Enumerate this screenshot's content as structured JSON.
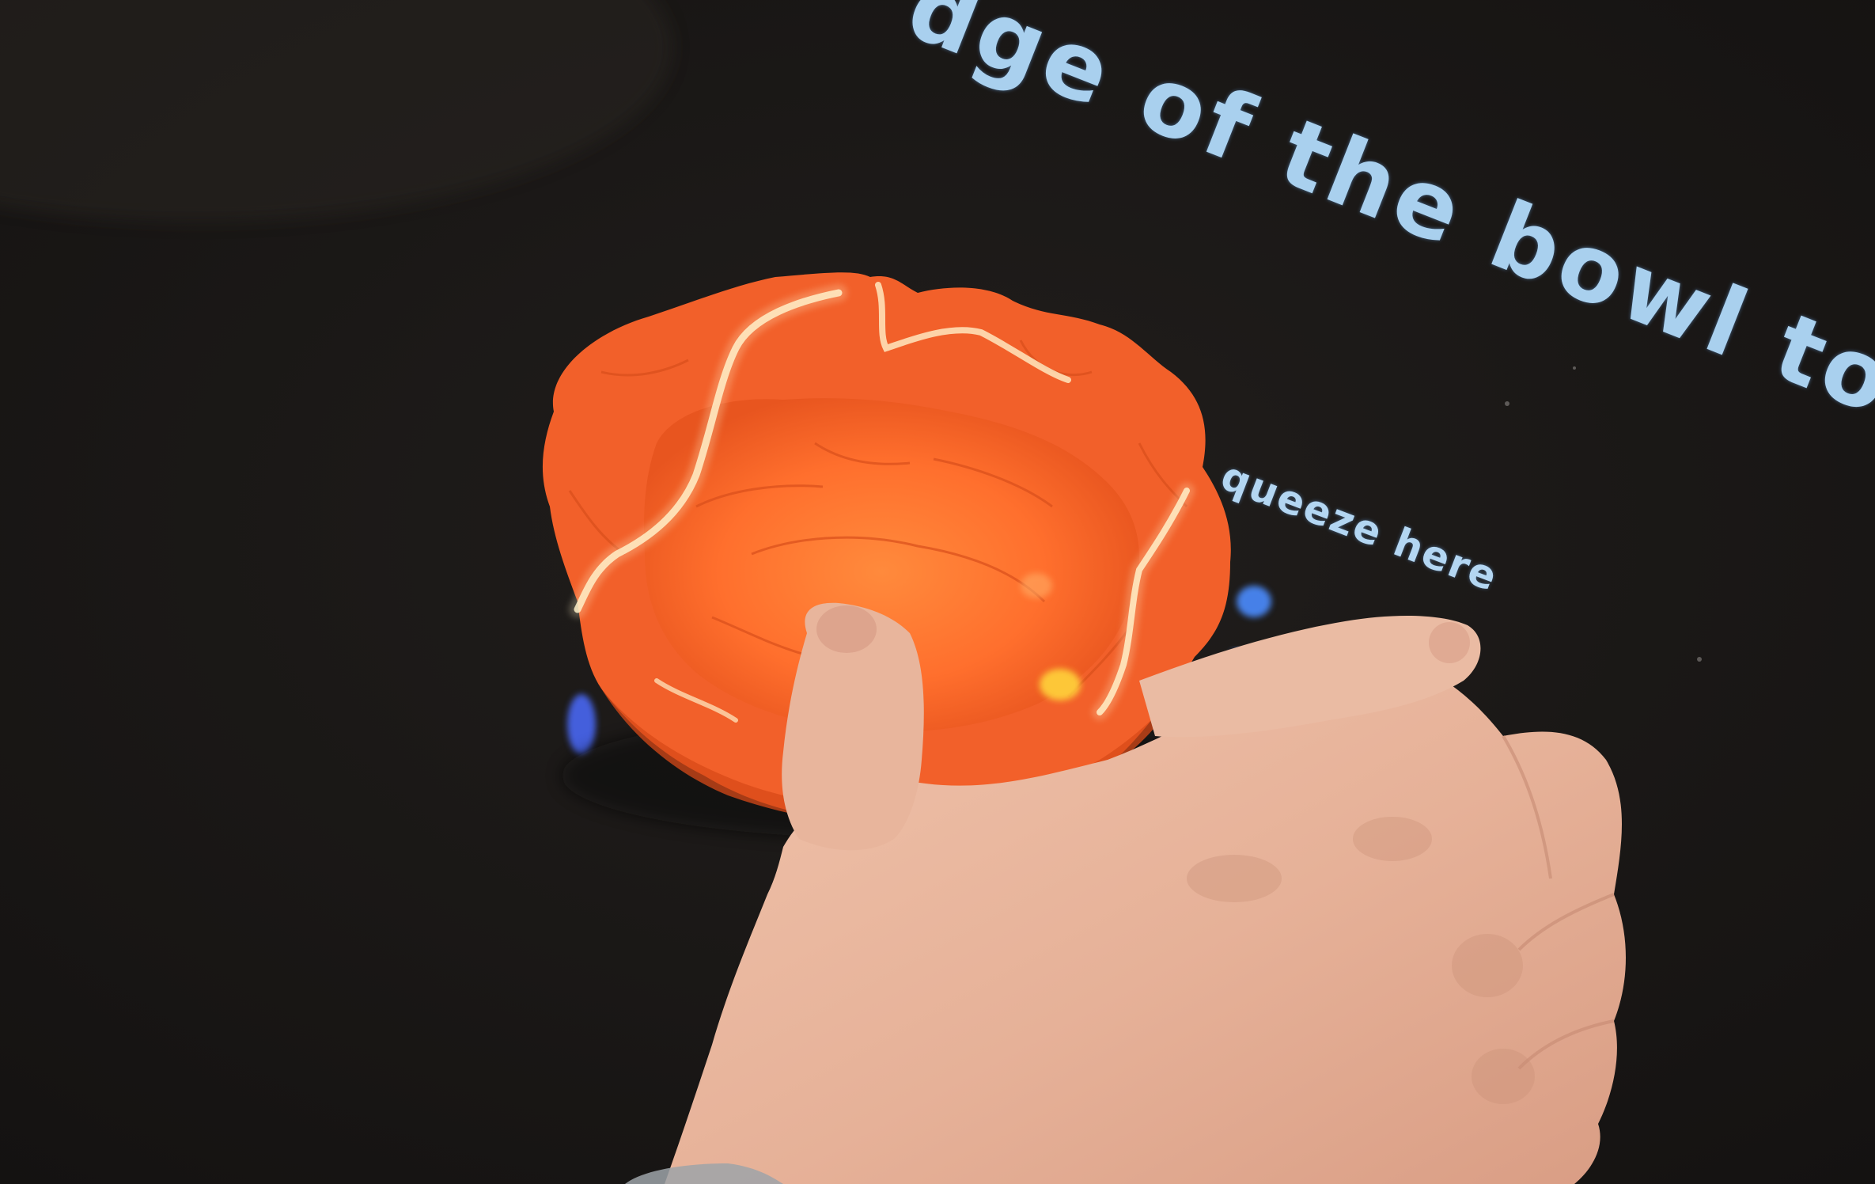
{
  "projection": {
    "instruction_text": "dge of the bowl to fit",
    "squeeze_label": "queeze here",
    "text_color": "#a9d0ee",
    "glow_color": "#4c8cff"
  },
  "scene": {
    "surface_color": "#1b1918",
    "clay_color": "#ff6a2a",
    "highlight_color": "#fff0c8",
    "skin_color": "#e8b79e"
  }
}
